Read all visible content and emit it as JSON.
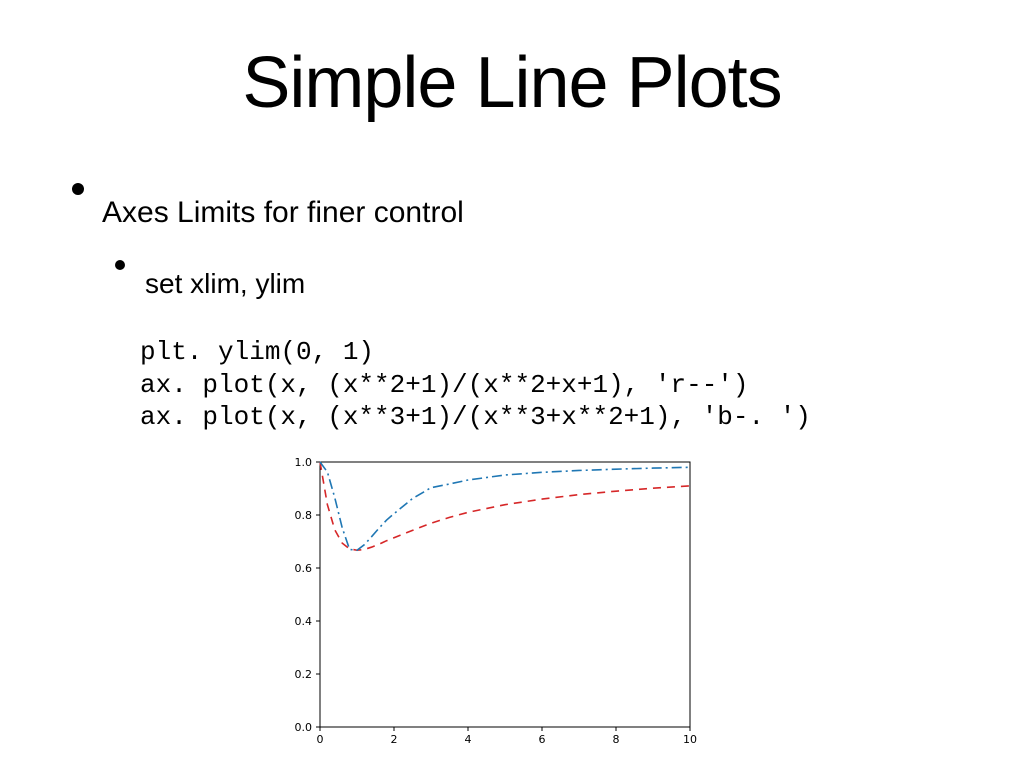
{
  "title": "Simple Line Plots",
  "bullets": {
    "l1": "Axes Limits for finer control",
    "l2": "set xlim, ylim"
  },
  "code": "plt. ylim(0, 1)\nax. plot(x, (x**2+1)/(x**2+x+1), 'r--')\nax. plot(x, (x**3+1)/(x**3+x**2+1), 'b-. ')",
  "chart_data": {
    "type": "line",
    "xlabel": "",
    "ylabel": "",
    "xlim": [
      0,
      10
    ],
    "ylim": [
      0,
      1
    ],
    "xticks": [
      0,
      2,
      4,
      6,
      8,
      10
    ],
    "yticks": [
      0.0,
      0.2,
      0.4,
      0.6,
      0.8,
      1.0
    ],
    "ytick_labels": [
      "0.0",
      "0.2",
      "0.4",
      "0.6",
      "0.8",
      "1.0"
    ],
    "series": [
      {
        "name": "(x**2+1)/(x**2+x+1)",
        "style": "r--",
        "color": "#d62728",
        "x": [
          0,
          0.2,
          0.4,
          0.6,
          0.8,
          1.0,
          1.2,
          1.4,
          1.6,
          1.8,
          2.0,
          2.5,
          3.0,
          3.5,
          4.0,
          5.0,
          6.0,
          7.0,
          8.0,
          9.0,
          10.0
        ],
        "y": [
          1.0,
          0.839,
          0.744,
          0.694,
          0.672,
          0.667,
          0.67,
          0.679,
          0.69,
          0.703,
          0.714,
          0.742,
          0.769,
          0.791,
          0.81,
          0.839,
          0.86,
          0.877,
          0.89,
          0.901,
          0.91
        ]
      },
      {
        "name": "(x**3+1)/(x**3+x**2+1)",
        "style": "b-.",
        "color": "#1f77b4",
        "x": [
          0,
          0.2,
          0.4,
          0.6,
          0.8,
          1.0,
          1.2,
          1.4,
          1.6,
          1.8,
          2.0,
          2.5,
          3.0,
          3.5,
          4.0,
          5.0,
          6.0,
          7.0,
          8.0,
          9.0,
          10.0
        ],
        "y": [
          1.0,
          0.962,
          0.865,
          0.752,
          0.67,
          0.667,
          0.688,
          0.719,
          0.751,
          0.781,
          0.805,
          0.862,
          0.903,
          0.917,
          0.932,
          0.951,
          0.961,
          0.968,
          0.973,
          0.977,
          0.98
        ]
      }
    ]
  }
}
